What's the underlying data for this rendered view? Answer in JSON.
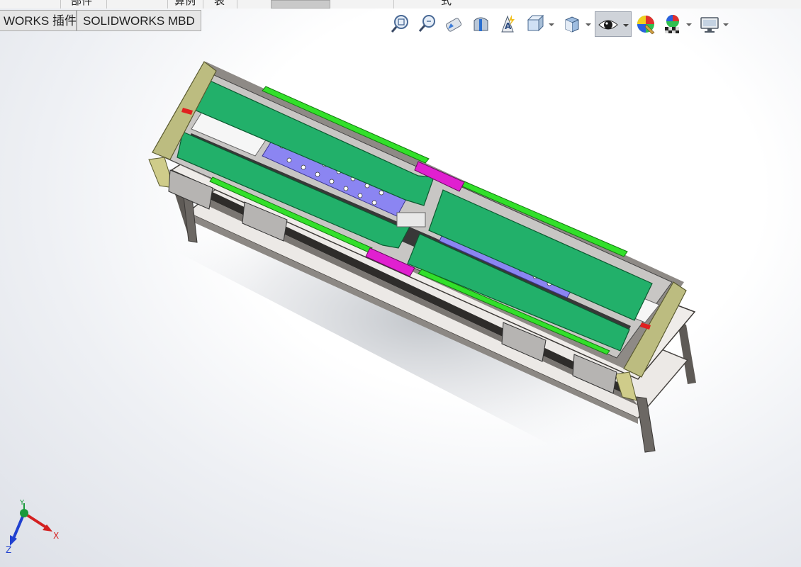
{
  "ribbon": {
    "items": [
      "部件",
      "算例",
      "表",
      "式"
    ]
  },
  "tabs": [
    {
      "label": "WORKS 插件"
    },
    {
      "label": "SOLIDWORKS MBD"
    }
  ],
  "view_toolbar": {
    "icons": [
      "zoom-to-fit-icon",
      "zoom-to-area-icon",
      "previous-view-icon",
      "section-view-icon",
      "dynamic-annotation-views-icon",
      "view-orientation-icon",
      "display-style-icon",
      "hide-show-items-icon",
      "edit-appearance-icon",
      "apply-scene-icon",
      "view-settings-icon"
    ]
  },
  "triad": {
    "x_label": "X",
    "y_label": "Y",
    "z_label": "Z",
    "colors": {
      "x": "#d42020",
      "y": "#1a9a3a",
      "z": "#2040d0"
    }
  },
  "colors": {
    "belt": "#22b06a",
    "plate": "#8080f0",
    "magenta": "#e020d0",
    "bright_green": "#32e02a",
    "olive": "#bcbc80",
    "frame": "#ece9e6"
  }
}
